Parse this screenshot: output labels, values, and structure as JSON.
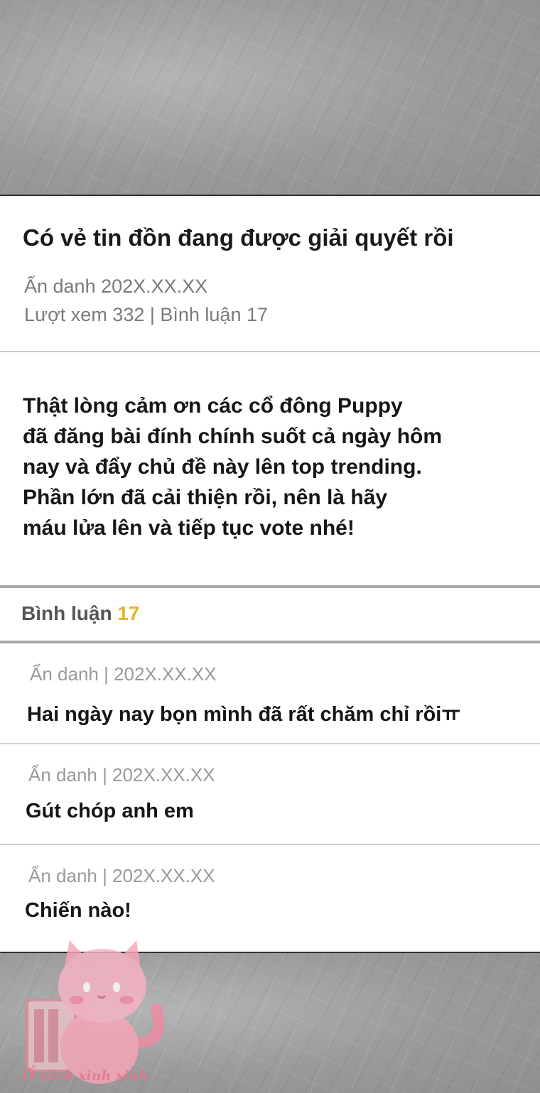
{
  "post": {
    "title": "Có vẻ tin đồn đang được giải quyết rồi",
    "author_date": "Ẩn danh 202X.XX.XX",
    "stats": "Lượt xem 332 | Bình luận 17",
    "body_lines": [
      "Thật lòng cảm ơn các cổ đông Puppy",
      "đã đăng bài đính chính suốt cả ngày hôm",
      "nay và đẩy chủ đề này lên top trending.",
      "Phần lớn đã cải thiện rồi, nên là hãy",
      "máu lửa lên và tiếp tục vote nhé!"
    ]
  },
  "comments_section": {
    "label": "Bình luận",
    "count": "17"
  },
  "comments": [
    {
      "meta": "Ẩn danh | 202X.XX.XX",
      "text": "Hai ngày nay bọn mình đã rất chăm chỉ rồiㅠ"
    },
    {
      "meta": "Ẩn danh | 202X.XX.XX",
      "text": "Gút chóp anh em"
    },
    {
      "meta": "Ẩn danh | 202X.XX.XX",
      "text": "Chiến nào!"
    }
  ],
  "watermark": {
    "text": "Ổ sách xinh xinh",
    "icon": "pink-cat-mascot-icon"
  },
  "colors": {
    "accent_count": "#e6b431",
    "meta_gray": "#7a7a7a",
    "watermark_pink": "#e8758c"
  }
}
